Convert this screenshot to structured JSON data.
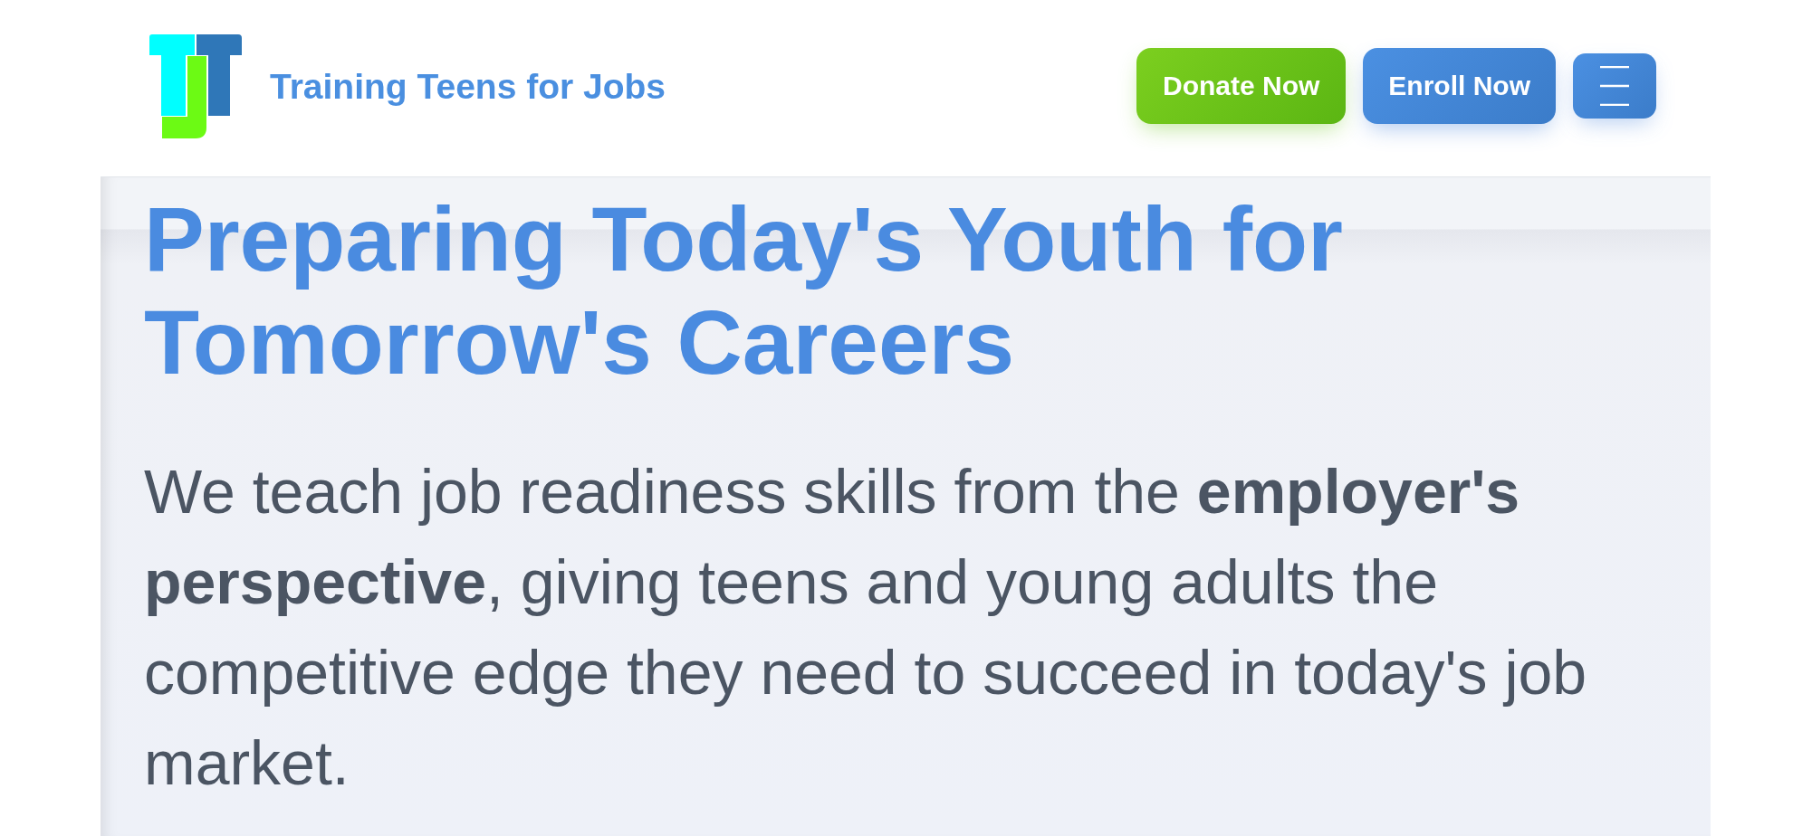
{
  "header": {
    "site_name": "Training Teens for Jobs",
    "buttons": [
      {
        "label": "Donate Now",
        "kind": "donate"
      },
      {
        "label": "Enroll Now",
        "kind": "enroll"
      }
    ]
  },
  "hero": {
    "heading": "Preparing Today's Youth for Tomorrow's Careers",
    "body": "We teach job readiness skills from the **employer's perspective**, giving teens and young adults the competitive edge they need to succeed in today's job market."
  }
}
